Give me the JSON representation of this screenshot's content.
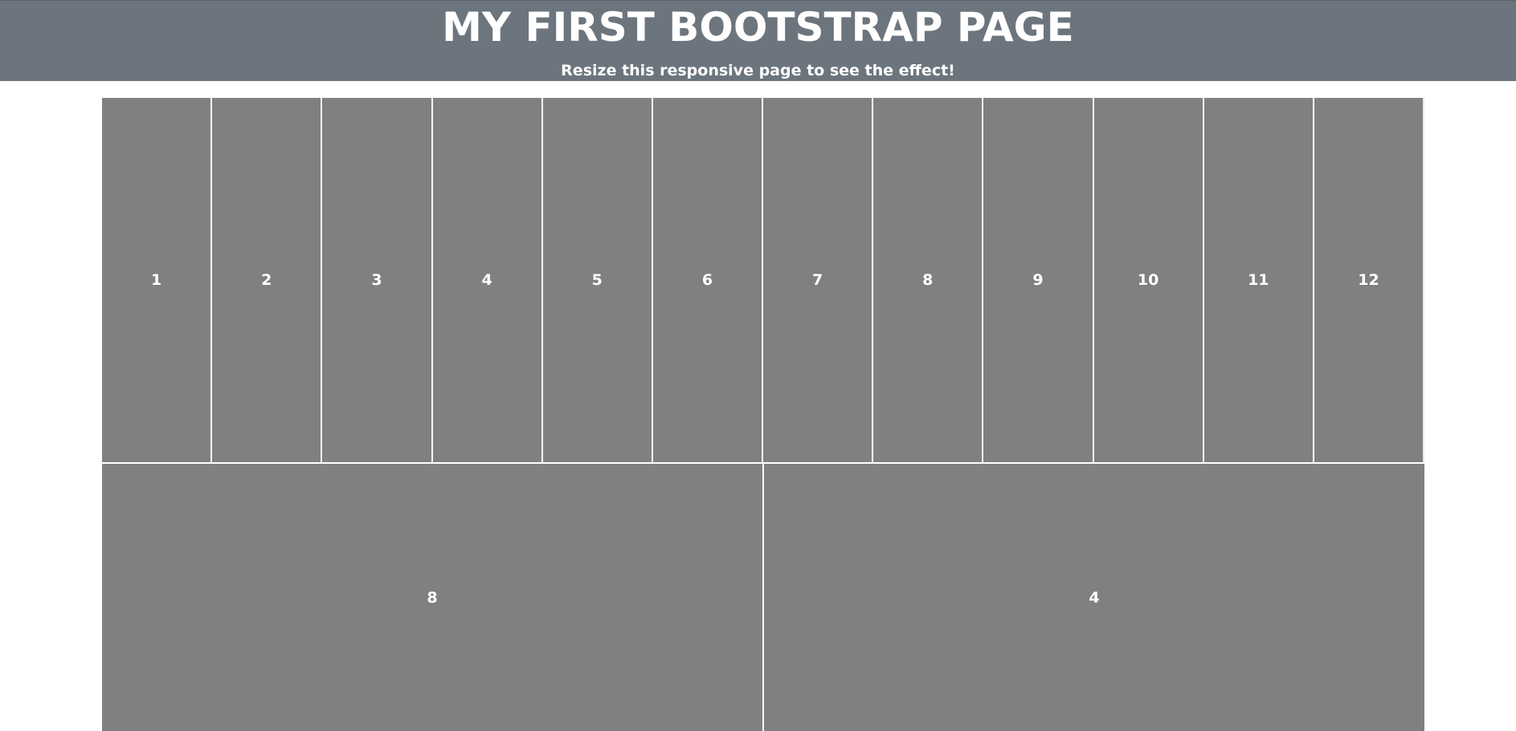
{
  "header": {
    "title": "MY FIRST BOOTSTRAP PAGE",
    "subtitle": "Resize this responsive page to see the effect!"
  },
  "grid": {
    "row1": [
      "1",
      "2",
      "3",
      "4",
      "5",
      "6",
      "7",
      "8",
      "9",
      "10",
      "11",
      "12"
    ],
    "row2": [
      "8",
      "4"
    ]
  },
  "colors": {
    "header_bg": "#6c757d",
    "cell_bg": "#808080",
    "text": "#ffffff"
  }
}
